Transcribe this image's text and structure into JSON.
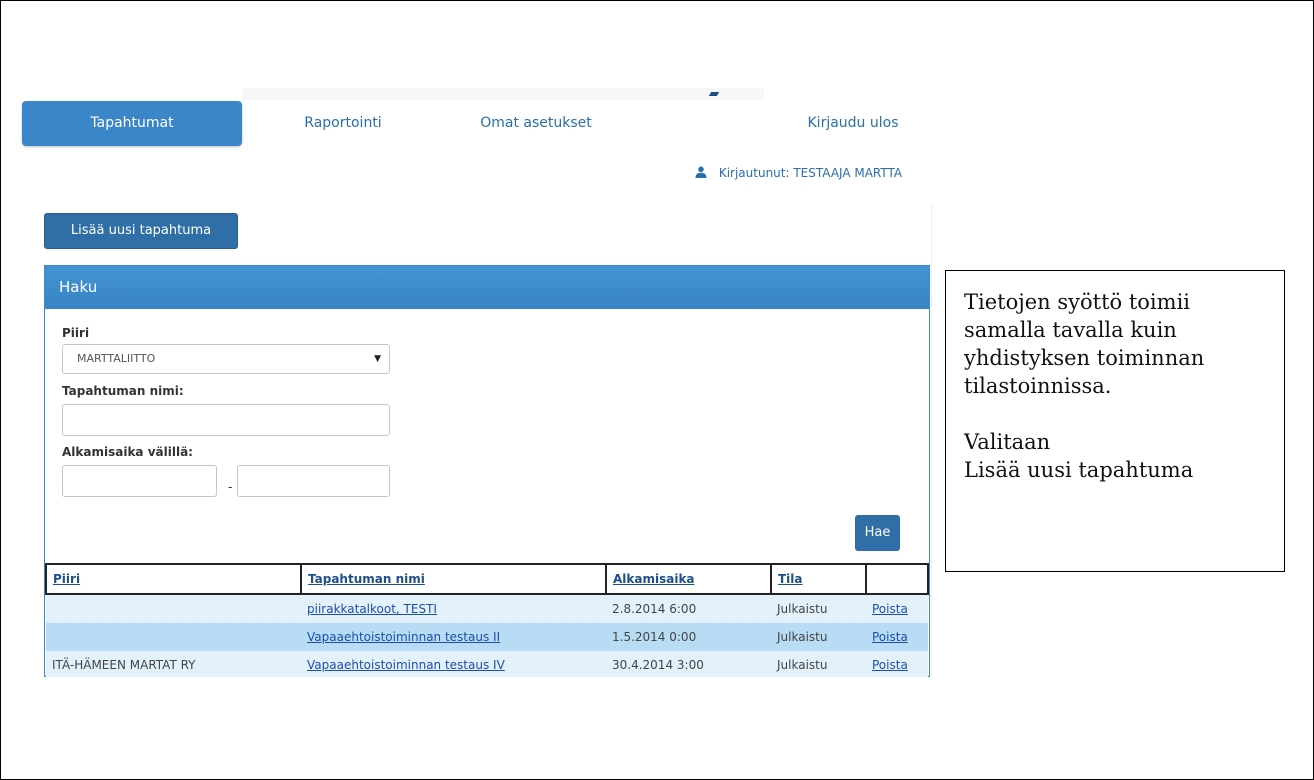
{
  "nav": {
    "items": [
      {
        "label": "Tapahtumat",
        "active": true
      },
      {
        "label": "Raportointi",
        "active": false
      },
      {
        "label": "Omat asetukset",
        "active": false
      },
      {
        "label": "Kirjaudu ulos",
        "active": false
      }
    ]
  },
  "user": {
    "label": "Kirjautunut: TESTAAJA MARTTA",
    "icon": "user-icon"
  },
  "actions": {
    "add_event_label": "Lisää uusi tapahtuma"
  },
  "search": {
    "title": "Haku",
    "piiri_label": "Piiri",
    "piiri_value": "MARTTALIITTO",
    "name_label": "Tapahtuman nimi:",
    "name_value": "",
    "date_label": "Alkamisaika välillä:",
    "date_from": "",
    "date_separator": "-",
    "date_to": "",
    "search_button": "Hae"
  },
  "table": {
    "headers": [
      "Piiri",
      "Tapahtuman nimi",
      "Alkamisaika",
      "Tila",
      ""
    ],
    "rows": [
      {
        "piiri": "",
        "name": "piirakkatalkoot, TESTI",
        "start": "2.8.2014 6:00",
        "status": "Julkaistu",
        "action": "Poista"
      },
      {
        "piiri": "",
        "name": "Vapaaehtoistoiminnan testaus II",
        "start": "1.5.2014 0:00",
        "status": "Julkaistu",
        "action": "Poista"
      },
      {
        "piiri": "ITÄ-HÄMEEN MARTAT RY",
        "name": "Vapaaehtoistoiminnan testaus IV",
        "start": "30.4.2014 3:00",
        "status": "Julkaistu",
        "action": "Poista"
      }
    ]
  },
  "callout": {
    "line1": "Tietojen syöttö toimii",
    "line2": "samalla tavalla kuin",
    "line3": "yhdistyksen toiminnan",
    "line4": "tilastoinnissa.",
    "line5": "Valitaan",
    "line6": "Lisää uusi tapahtuma"
  },
  "colors": {
    "accent": "#3b86c8",
    "button": "#2f6ea6",
    "link": "#1d4fa8",
    "row_light": "#e3f1fb",
    "row_highlight": "#b8dcf3"
  }
}
